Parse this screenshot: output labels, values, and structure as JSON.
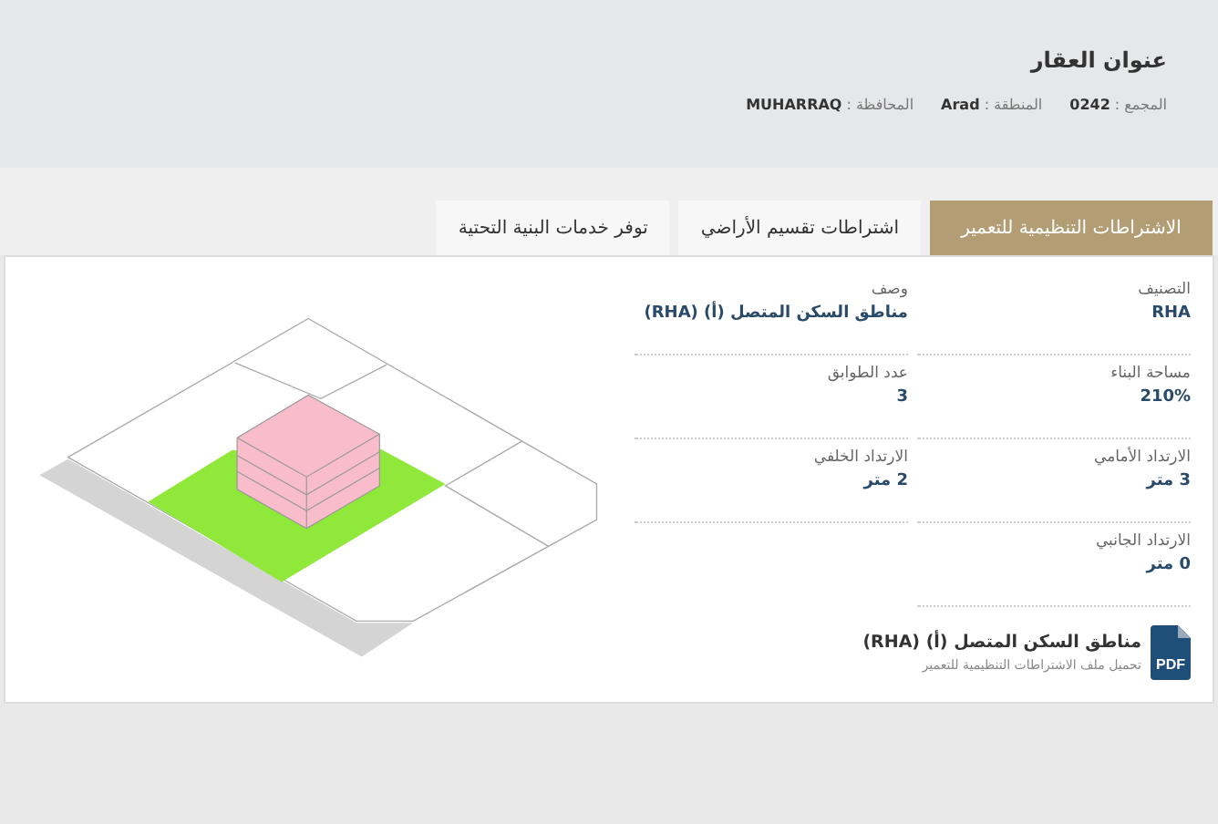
{
  "header": {
    "title": "عنوان العقار",
    "meta": [
      {
        "label": "المجمع :",
        "value": "0242"
      },
      {
        "label": "المنطقة :",
        "value": "Arad"
      },
      {
        "label": "المحافظة :",
        "value": "MUHARRAQ"
      }
    ]
  },
  "tabs": [
    {
      "label": "الاشتراطات التنظيمية للتعمير",
      "selected": true
    },
    {
      "label": "اشتراطات تقسيم الأراضي",
      "selected": false
    },
    {
      "label": "توفر خدمات البنية التحتية",
      "selected": false
    }
  ],
  "fields": [
    {
      "label": "التصنيف",
      "value": "RHA"
    },
    {
      "label": "وصف",
      "value": "مناطق السكن المتصل (أ) (RHA)"
    },
    {
      "label": "مساحة البناء",
      "value": "210%"
    },
    {
      "label": "عدد الطوابق",
      "value": "3"
    },
    {
      "label": "الارتداد الأمامي",
      "value": "3 متر"
    },
    {
      "label": "الارتداد الخلفي",
      "value": "2 متر"
    },
    {
      "label": "الارتداد الجانبي",
      "value": "0 متر"
    }
  ],
  "download": {
    "icon_text": "PDF",
    "title": "مناطق السكن المتصل (أ) (RHA)",
    "subtitle": "تحميل ملف الاشتراطات التنظيمية للتعمير"
  }
}
